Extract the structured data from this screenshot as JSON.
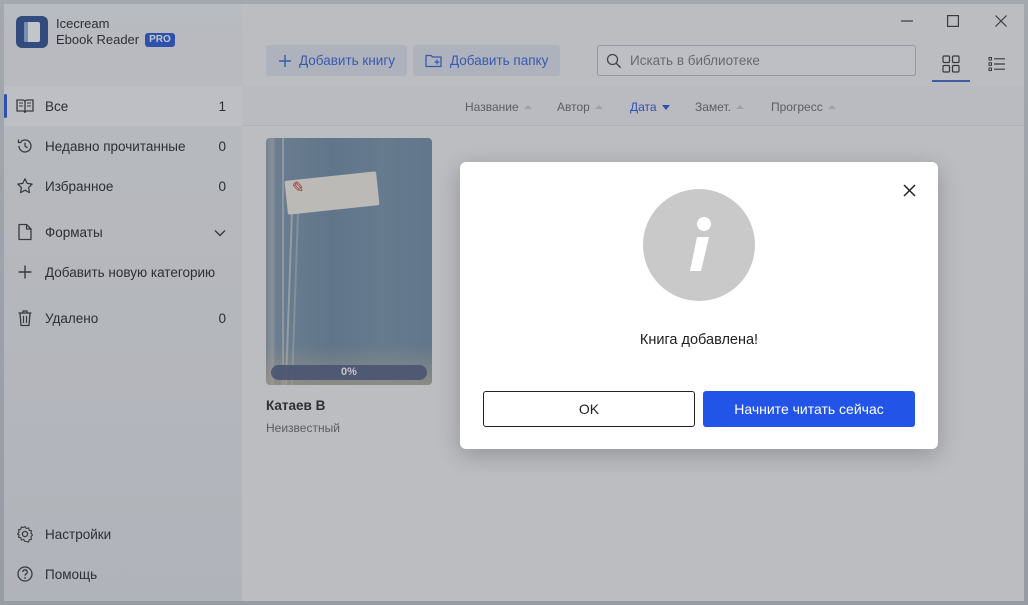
{
  "app": {
    "name_line1": "Icecream",
    "name_line2": "Ebook Reader",
    "badge": "PRO"
  },
  "sidebar": {
    "items": [
      {
        "label": "Все",
        "count": "1",
        "icon": "book-open-icon"
      },
      {
        "label": "Недавно прочитанные",
        "count": "0",
        "icon": "history-icon"
      },
      {
        "label": "Избранное",
        "count": "0",
        "icon": "star-icon"
      },
      {
        "label": "Форматы",
        "icon": "document-icon"
      },
      {
        "label": "Добавить новую категорию",
        "icon": "plus-icon"
      },
      {
        "label": "Удалено",
        "count": "0",
        "icon": "trash-icon"
      }
    ],
    "bottom": [
      {
        "label": "Настройки",
        "icon": "gear-icon"
      },
      {
        "label": "Помощь",
        "icon": "help-icon"
      }
    ]
  },
  "toolbar": {
    "add_book": "Добавить книгу",
    "add_folder": "Добавить папку",
    "search_placeholder": "Искать в библиотеке"
  },
  "sort": {
    "columns": [
      "Название",
      "Автор",
      "Дата",
      "Замет.",
      "Прогресс"
    ],
    "active": "Дата"
  },
  "books": [
    {
      "title": "Катаев В",
      "author": "Неизвестный",
      "progress": "0%",
      "progress_fraction": 0
    }
  ],
  "dialog": {
    "message": "Книга добавлена!",
    "ok_label": "OK",
    "read_label": "Начните читать сейчас"
  },
  "colors": {
    "accent": "#2254d6",
    "primary_button": "#2254e8",
    "info_circle": "#c9c9c9"
  }
}
